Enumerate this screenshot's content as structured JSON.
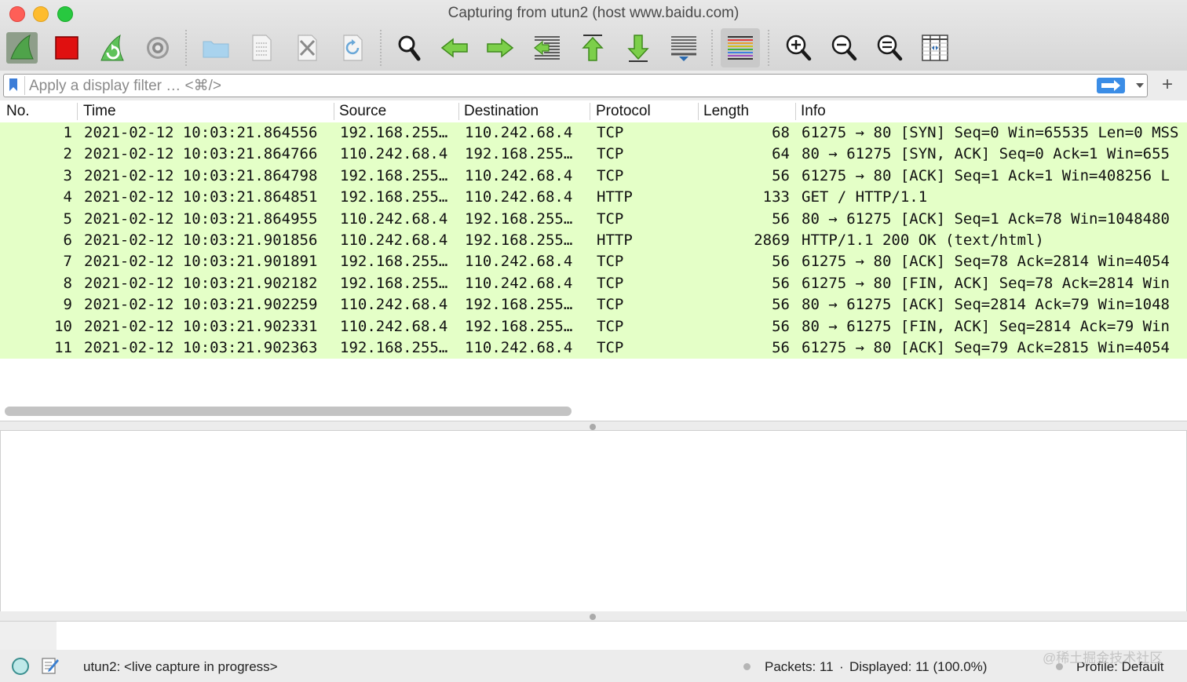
{
  "window": {
    "title": "Capturing from utun2 (host www.baidu.com)"
  },
  "toolbar": {
    "buttons": [
      {
        "name": "start-capture",
        "icon": "shark-fin-icon"
      },
      {
        "name": "stop-capture",
        "icon": "stop-icon"
      },
      {
        "name": "restart-capture",
        "icon": "restart-fin-icon"
      },
      {
        "name": "capture-options",
        "icon": "gear-icon"
      },
      {
        "name": "open-file",
        "icon": "folder-icon"
      },
      {
        "name": "save-file",
        "icon": "file-icon"
      },
      {
        "name": "close-file",
        "icon": "close-file-icon"
      },
      {
        "name": "reload-file",
        "icon": "reload-icon"
      },
      {
        "name": "find-packet",
        "icon": "magnifier-icon"
      },
      {
        "name": "go-back",
        "icon": "arrow-left-icon"
      },
      {
        "name": "go-forward",
        "icon": "arrow-right-icon"
      },
      {
        "name": "go-to-packet",
        "icon": "goto-packet-icon"
      },
      {
        "name": "first-packet",
        "icon": "arrow-up-icon"
      },
      {
        "name": "last-packet",
        "icon": "arrow-down-icon"
      },
      {
        "name": "autoscroll",
        "icon": "autoscroll-icon"
      },
      {
        "name": "colorize",
        "icon": "colorize-icon"
      },
      {
        "name": "zoom-in",
        "icon": "zoom-in-icon"
      },
      {
        "name": "zoom-out",
        "icon": "zoom-out-icon"
      },
      {
        "name": "normal-size",
        "icon": "zoom-reset-icon"
      },
      {
        "name": "resize-columns",
        "icon": "resize-columns-icon"
      }
    ]
  },
  "filter": {
    "placeholder": "Apply a display filter … <⌘/>"
  },
  "columns": [
    "No.",
    "Time",
    "Source",
    "Destination",
    "Protocol",
    "Length",
    "Info"
  ],
  "packets": [
    {
      "no": "1",
      "time": "2021-02-12 10:03:21.864556",
      "src": "192.168.255…",
      "dst": "110.242.68.4",
      "proto": "TCP",
      "len": "68",
      "info": "61275 → 80 [SYN] Seq=0 Win=65535 Len=0 MSS"
    },
    {
      "no": "2",
      "time": "2021-02-12 10:03:21.864766",
      "src": "110.242.68.4",
      "dst": "192.168.255…",
      "proto": "TCP",
      "len": "64",
      "info": "80 → 61275 [SYN, ACK] Seq=0 Ack=1 Win=655"
    },
    {
      "no": "3",
      "time": "2021-02-12 10:03:21.864798",
      "src": "192.168.255…",
      "dst": "110.242.68.4",
      "proto": "TCP",
      "len": "56",
      "info": "61275 → 80 [ACK] Seq=1 Ack=1 Win=408256 L"
    },
    {
      "no": "4",
      "time": "2021-02-12 10:03:21.864851",
      "src": "192.168.255…",
      "dst": "110.242.68.4",
      "proto": "HTTP",
      "len": "133",
      "info": "GET / HTTP/1.1"
    },
    {
      "no": "5",
      "time": "2021-02-12 10:03:21.864955",
      "src": "110.242.68.4",
      "dst": "192.168.255…",
      "proto": "TCP",
      "len": "56",
      "info": "80 → 61275 [ACK] Seq=1 Ack=78 Win=1048480"
    },
    {
      "no": "6",
      "time": "2021-02-12 10:03:21.901856",
      "src": "110.242.68.4",
      "dst": "192.168.255…",
      "proto": "HTTP",
      "len": "2869",
      "info": "HTTP/1.1 200 OK  (text/html)"
    },
    {
      "no": "7",
      "time": "2021-02-12 10:03:21.901891",
      "src": "192.168.255…",
      "dst": "110.242.68.4",
      "proto": "TCP",
      "len": "56",
      "info": "61275 → 80 [ACK] Seq=78 Ack=2814 Win=4054"
    },
    {
      "no": "8",
      "time": "2021-02-12 10:03:21.902182",
      "src": "192.168.255…",
      "dst": "110.242.68.4",
      "proto": "TCP",
      "len": "56",
      "info": "61275 → 80 [FIN, ACK] Seq=78 Ack=2814 Win"
    },
    {
      "no": "9",
      "time": "2021-02-12 10:03:21.902259",
      "src": "110.242.68.4",
      "dst": "192.168.255…",
      "proto": "TCP",
      "len": "56",
      "info": "80 → 61275 [ACK] Seq=2814 Ack=79 Win=1048"
    },
    {
      "no": "10",
      "time": "2021-02-12 10:03:21.902331",
      "src": "110.242.68.4",
      "dst": "192.168.255…",
      "proto": "TCP",
      "len": "56",
      "info": "80 → 61275 [FIN, ACK] Seq=2814 Ack=79 Win"
    },
    {
      "no": "11",
      "time": "2021-02-12 10:03:21.902363",
      "src": "192.168.255…",
      "dst": "110.242.68.4",
      "proto": "TCP",
      "len": "56",
      "info": "61275 → 80 [ACK] Seq=79 Ack=2815 Win=4054"
    }
  ],
  "colors": {
    "tcp_row": "#e4ffc7",
    "stop_red": "#e01010",
    "apply_blue": "#3b8de6"
  },
  "status": {
    "interface": "utun2: <live capture in progress>",
    "packets": "Packets: 11",
    "separator": "·",
    "displayed": "Displayed: 11 (100.0%)",
    "profile": "Profile: Default"
  },
  "watermark": "@稀土掘金技术社区"
}
